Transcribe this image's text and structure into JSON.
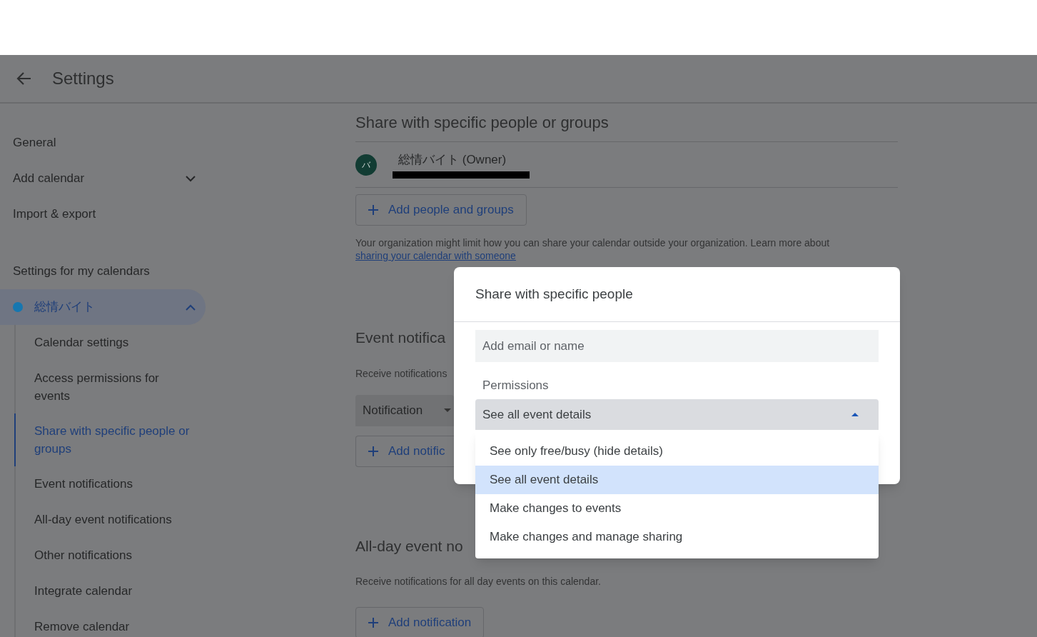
{
  "header": {
    "title": "Settings"
  },
  "sidebar": {
    "items": [
      {
        "label": "General",
        "kind": "link"
      },
      {
        "label": "Add calendar",
        "kind": "expander",
        "expanded": false
      },
      {
        "label": "Import & export",
        "kind": "link"
      }
    ],
    "section_title": "Settings for my calendars",
    "calendars": [
      {
        "name": "総情バイト",
        "color": "#1677b0",
        "selected": true,
        "expanded": true,
        "children": [
          {
            "label": "Calendar settings",
            "selected": false
          },
          {
            "label": "Access permissions for events",
            "selected": false
          },
          {
            "label": "Share with specific people or groups",
            "selected": true
          },
          {
            "label": "Event notifications",
            "selected": false
          },
          {
            "label": "All-day event notifications",
            "selected": false
          },
          {
            "label": "Other notifications",
            "selected": false
          },
          {
            "label": "Integrate calendar",
            "selected": false
          },
          {
            "label": "Remove calendar",
            "selected": false
          }
        ]
      }
    ]
  },
  "sharing": {
    "title": "Share with specific people or groups",
    "people": [
      {
        "initial": "バ",
        "name": "総情バイト (Owner)",
        "email_redacted": true
      }
    ],
    "add_button": "Add people and groups",
    "note": "Your organization might limit how you can share your calendar outside your organization. Learn more about",
    "note_link": "sharing your calendar with someone"
  },
  "event_notifications": {
    "title": "Event notifica",
    "description": "Receive notifications",
    "select": "Notification",
    "add_button": "Add notific"
  },
  "allday_notifications": {
    "title": "All-day event no",
    "description": "Receive notifications for all day events on this calendar.",
    "add_button": "Add notification"
  },
  "dialog": {
    "title": "Share with specific people",
    "email_field": {
      "placeholder": "Add email or name"
    },
    "permissions": {
      "label": "Permissions",
      "value": "See all event details",
      "expanded": true,
      "options": [
        {
          "label": "See only free/busy (hide details)",
          "selected": false
        },
        {
          "label": "See all event details",
          "selected": true
        },
        {
          "label": "Make changes to events",
          "selected": false
        },
        {
          "label": "Make changes and manage sharing",
          "selected": false
        }
      ]
    }
  }
}
